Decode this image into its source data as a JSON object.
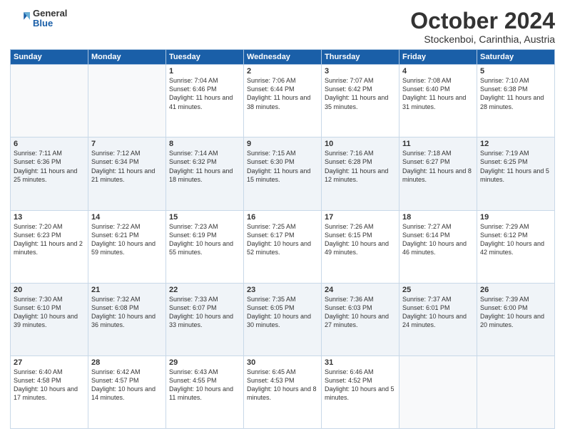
{
  "logo": {
    "line1": "General",
    "line2": "Blue"
  },
  "title": "October 2024",
  "location": "Stockenboi, Carinthia, Austria",
  "days_header": [
    "Sunday",
    "Monday",
    "Tuesday",
    "Wednesday",
    "Thursday",
    "Friday",
    "Saturday"
  ],
  "weeks": [
    [
      {
        "day": "",
        "info": ""
      },
      {
        "day": "",
        "info": ""
      },
      {
        "day": "1",
        "info": "Sunrise: 7:04 AM\nSunset: 6:46 PM\nDaylight: 11 hours\nand 41 minutes."
      },
      {
        "day": "2",
        "info": "Sunrise: 7:06 AM\nSunset: 6:44 PM\nDaylight: 11 hours\nand 38 minutes."
      },
      {
        "day": "3",
        "info": "Sunrise: 7:07 AM\nSunset: 6:42 PM\nDaylight: 11 hours\nand 35 minutes."
      },
      {
        "day": "4",
        "info": "Sunrise: 7:08 AM\nSunset: 6:40 PM\nDaylight: 11 hours\nand 31 minutes."
      },
      {
        "day": "5",
        "info": "Sunrise: 7:10 AM\nSunset: 6:38 PM\nDaylight: 11 hours\nand 28 minutes."
      }
    ],
    [
      {
        "day": "6",
        "info": "Sunrise: 7:11 AM\nSunset: 6:36 PM\nDaylight: 11 hours\nand 25 minutes."
      },
      {
        "day": "7",
        "info": "Sunrise: 7:12 AM\nSunset: 6:34 PM\nDaylight: 11 hours\nand 21 minutes."
      },
      {
        "day": "8",
        "info": "Sunrise: 7:14 AM\nSunset: 6:32 PM\nDaylight: 11 hours\nand 18 minutes."
      },
      {
        "day": "9",
        "info": "Sunrise: 7:15 AM\nSunset: 6:30 PM\nDaylight: 11 hours\nand 15 minutes."
      },
      {
        "day": "10",
        "info": "Sunrise: 7:16 AM\nSunset: 6:28 PM\nDaylight: 11 hours\nand 12 minutes."
      },
      {
        "day": "11",
        "info": "Sunrise: 7:18 AM\nSunset: 6:27 PM\nDaylight: 11 hours\nand 8 minutes."
      },
      {
        "day": "12",
        "info": "Sunrise: 7:19 AM\nSunset: 6:25 PM\nDaylight: 11 hours\nand 5 minutes."
      }
    ],
    [
      {
        "day": "13",
        "info": "Sunrise: 7:20 AM\nSunset: 6:23 PM\nDaylight: 11 hours\nand 2 minutes."
      },
      {
        "day": "14",
        "info": "Sunrise: 7:22 AM\nSunset: 6:21 PM\nDaylight: 10 hours\nand 59 minutes."
      },
      {
        "day": "15",
        "info": "Sunrise: 7:23 AM\nSunset: 6:19 PM\nDaylight: 10 hours\nand 55 minutes."
      },
      {
        "day": "16",
        "info": "Sunrise: 7:25 AM\nSunset: 6:17 PM\nDaylight: 10 hours\nand 52 minutes."
      },
      {
        "day": "17",
        "info": "Sunrise: 7:26 AM\nSunset: 6:15 PM\nDaylight: 10 hours\nand 49 minutes."
      },
      {
        "day": "18",
        "info": "Sunrise: 7:27 AM\nSunset: 6:14 PM\nDaylight: 10 hours\nand 46 minutes."
      },
      {
        "day": "19",
        "info": "Sunrise: 7:29 AM\nSunset: 6:12 PM\nDaylight: 10 hours\nand 42 minutes."
      }
    ],
    [
      {
        "day": "20",
        "info": "Sunrise: 7:30 AM\nSunset: 6:10 PM\nDaylight: 10 hours\nand 39 minutes."
      },
      {
        "day": "21",
        "info": "Sunrise: 7:32 AM\nSunset: 6:08 PM\nDaylight: 10 hours\nand 36 minutes."
      },
      {
        "day": "22",
        "info": "Sunrise: 7:33 AM\nSunset: 6:07 PM\nDaylight: 10 hours\nand 33 minutes."
      },
      {
        "day": "23",
        "info": "Sunrise: 7:35 AM\nSunset: 6:05 PM\nDaylight: 10 hours\nand 30 minutes."
      },
      {
        "day": "24",
        "info": "Sunrise: 7:36 AM\nSunset: 6:03 PM\nDaylight: 10 hours\nand 27 minutes."
      },
      {
        "day": "25",
        "info": "Sunrise: 7:37 AM\nSunset: 6:01 PM\nDaylight: 10 hours\nand 24 minutes."
      },
      {
        "day": "26",
        "info": "Sunrise: 7:39 AM\nSunset: 6:00 PM\nDaylight: 10 hours\nand 20 minutes."
      }
    ],
    [
      {
        "day": "27",
        "info": "Sunrise: 6:40 AM\nSunset: 4:58 PM\nDaylight: 10 hours\nand 17 minutes."
      },
      {
        "day": "28",
        "info": "Sunrise: 6:42 AM\nSunset: 4:57 PM\nDaylight: 10 hours\nand 14 minutes."
      },
      {
        "day": "29",
        "info": "Sunrise: 6:43 AM\nSunset: 4:55 PM\nDaylight: 10 hours\nand 11 minutes."
      },
      {
        "day": "30",
        "info": "Sunrise: 6:45 AM\nSunset: 4:53 PM\nDaylight: 10 hours\nand 8 minutes."
      },
      {
        "day": "31",
        "info": "Sunrise: 6:46 AM\nSunset: 4:52 PM\nDaylight: 10 hours\nand 5 minutes."
      },
      {
        "day": "",
        "info": ""
      },
      {
        "day": "",
        "info": ""
      }
    ]
  ]
}
